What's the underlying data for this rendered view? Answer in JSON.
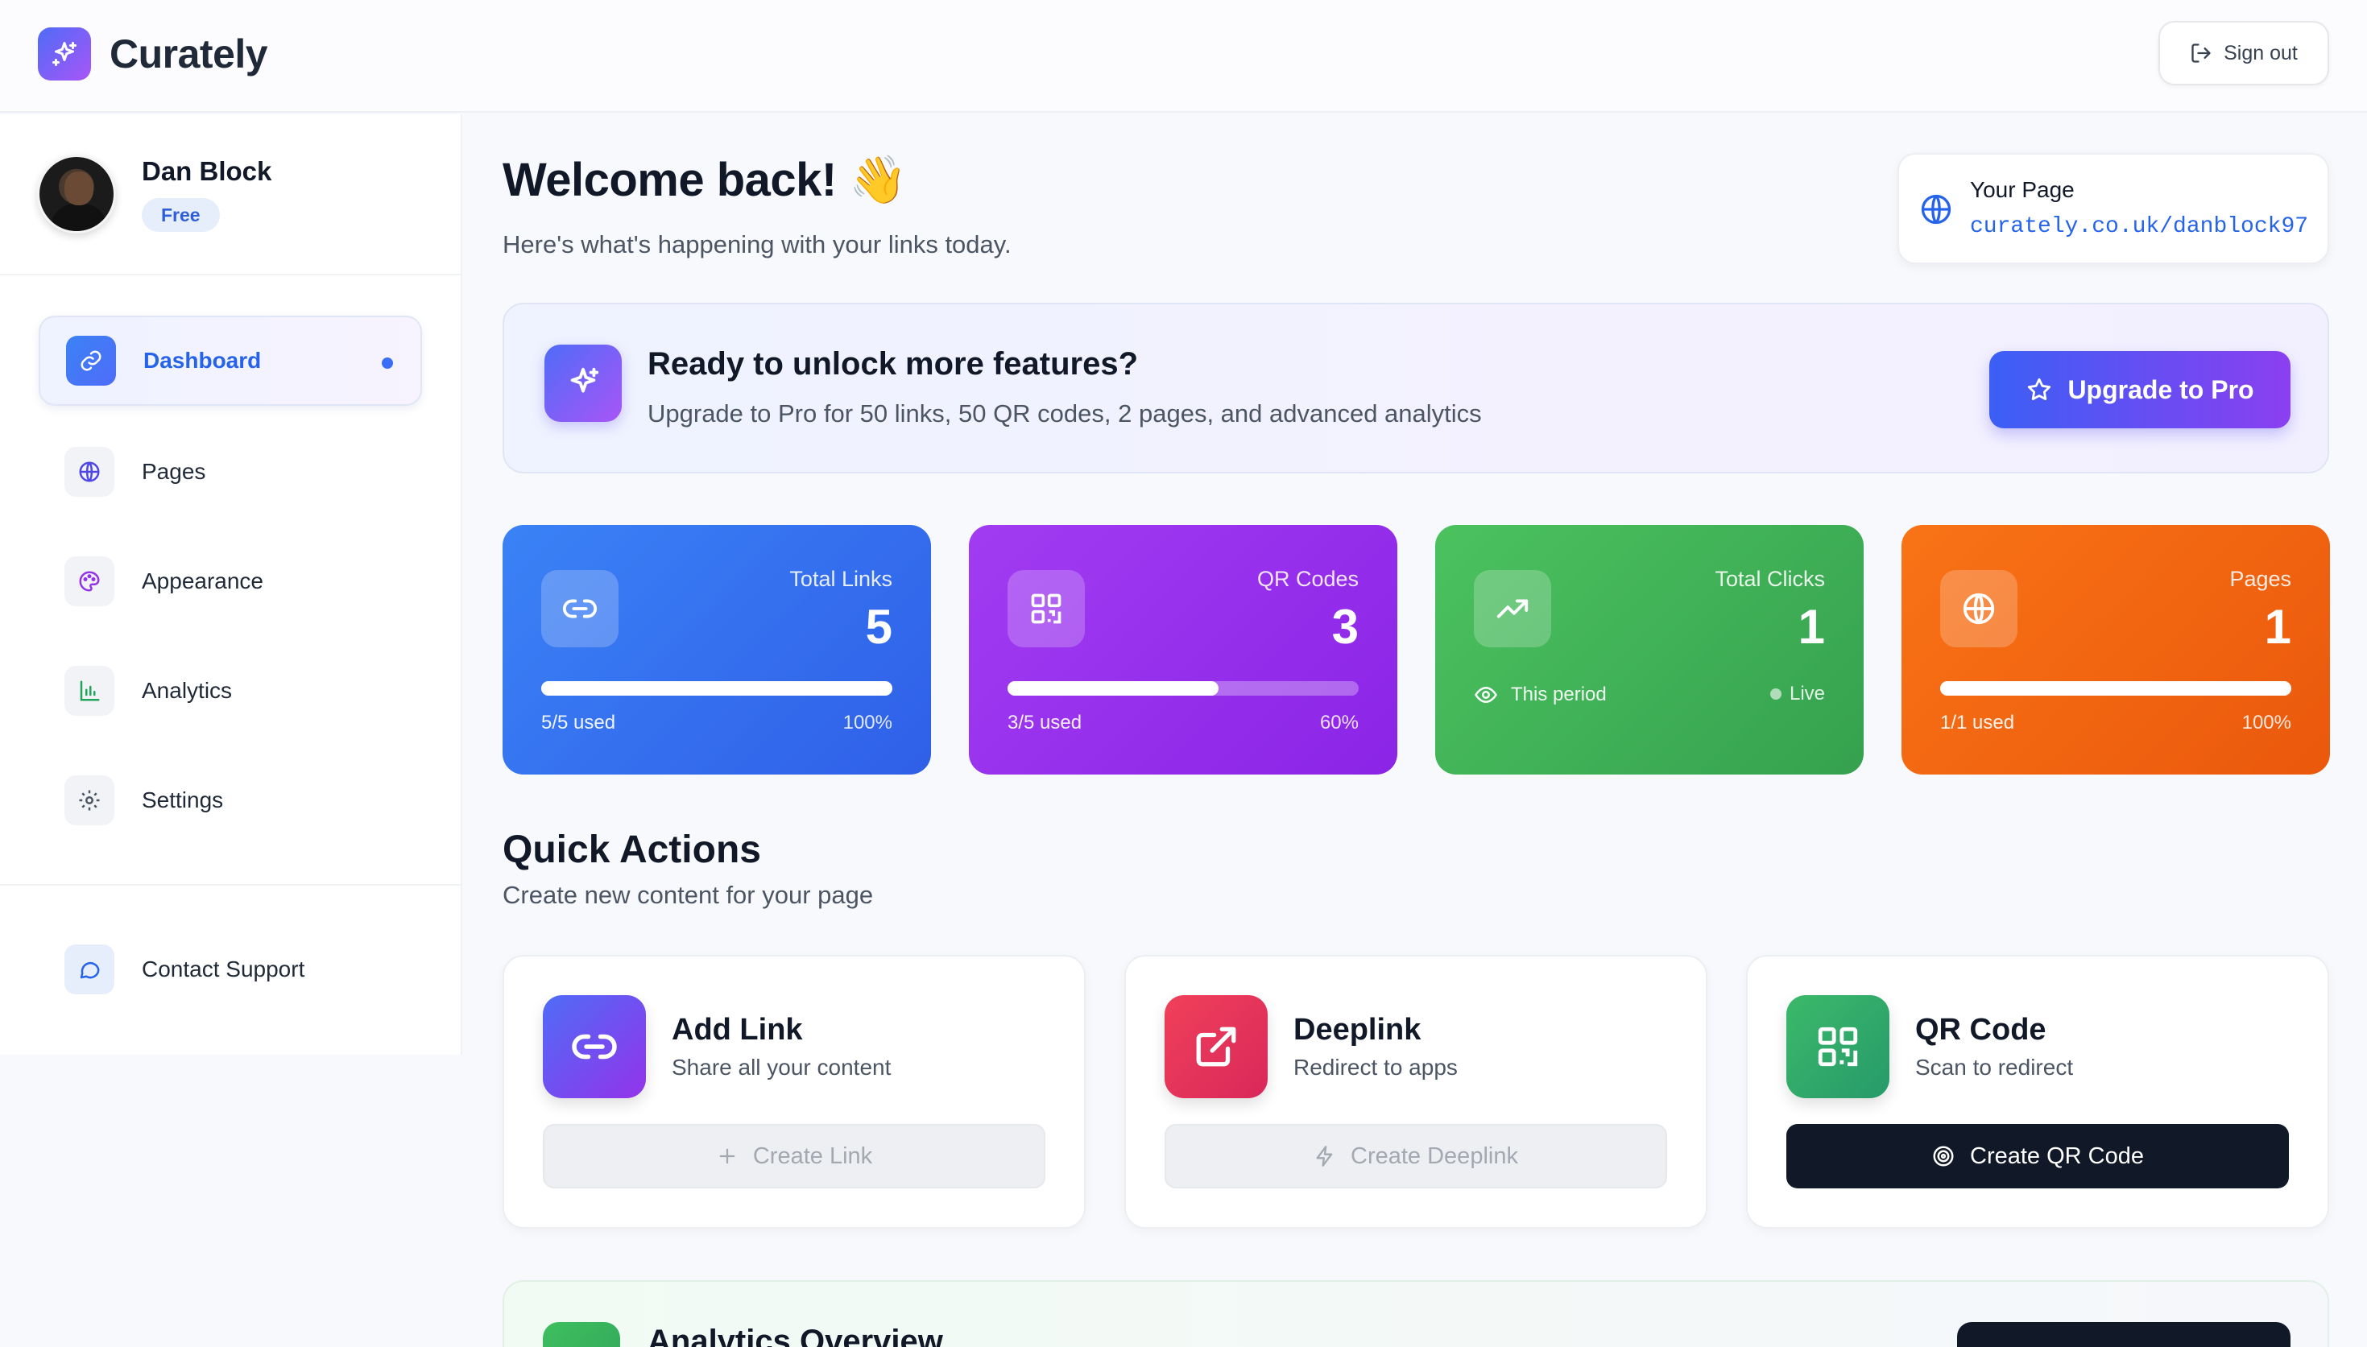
{
  "app": {
    "name": "Curately"
  },
  "header": {
    "sign_out_label": "Sign out"
  },
  "user": {
    "name": "Dan Block",
    "plan": "Free"
  },
  "sidebar": {
    "items": [
      {
        "label": "Dashboard",
        "icon": "link-icon",
        "active": true
      },
      {
        "label": "Pages",
        "icon": "globe-icon"
      },
      {
        "label": "Appearance",
        "icon": "palette-icon"
      },
      {
        "label": "Analytics",
        "icon": "bar-chart-icon"
      },
      {
        "label": "Settings",
        "icon": "gear-icon"
      }
    ],
    "support": {
      "label": "Contact Support",
      "icon": "chat-icon"
    }
  },
  "welcome": {
    "title": "Welcome back! 👋",
    "subtitle": "Here's what's happening with your links today."
  },
  "your_page": {
    "label": "Your Page",
    "url": "curately.co.uk/danblock97"
  },
  "promo": {
    "title": "Ready to unlock more features?",
    "subtitle": "Upgrade to Pro for 50 links, 50 QR codes, 2 pages, and advanced analytics",
    "button_label": "Upgrade to Pro"
  },
  "stats": [
    {
      "label": "Total Links",
      "value": "5",
      "usage": "5/5 used",
      "percent": "100%",
      "fill": 1.0,
      "color": "#3b6ef6"
    },
    {
      "label": "QR Codes",
      "value": "3",
      "usage": "3/5 used",
      "percent": "60%",
      "fill": 0.6,
      "color": "#9333ea"
    },
    {
      "label": "Total Clicks",
      "value": "1",
      "period": "This period",
      "status": "Live",
      "color": "#3fb35a"
    },
    {
      "label": "Pages",
      "value": "1",
      "usage": "1/1 used",
      "percent": "100%",
      "fill": 1.0,
      "color": "#f06a16"
    }
  ],
  "quick_actions": {
    "title": "Quick Actions",
    "subtitle": "Create new content for your page",
    "cards": [
      {
        "name": "Add Link",
        "desc": "Share all your content",
        "button": "Create Link",
        "disabled": true,
        "color": "#5b5cf6"
      },
      {
        "name": "Deeplink",
        "desc": "Redirect to apps",
        "button": "Create Deeplink",
        "disabled": true,
        "color": "#e43b5c"
      },
      {
        "name": "QR Code",
        "desc": "Scan to redirect",
        "button": "Create QR Code",
        "disabled": false,
        "color": "#2fa36a"
      }
    ]
  },
  "analytics_overview": {
    "title": "Analytics Overview"
  }
}
